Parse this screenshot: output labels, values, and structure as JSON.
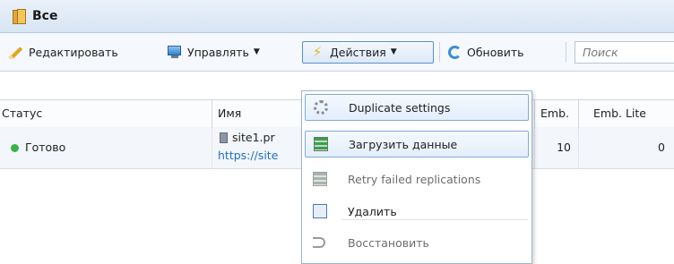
{
  "title": {
    "text": "Все",
    "icon": "folder-icon"
  },
  "toolbar": {
    "edit": {
      "label": "Редактировать",
      "icon": "pencil-icon"
    },
    "manage": {
      "label": "Управлять",
      "icon": "monitor-icon"
    },
    "actions": {
      "label": "Действия",
      "icon": "lightning-icon"
    },
    "refresh": {
      "label": "Обновить",
      "icon": "refresh-icon"
    },
    "search": {
      "placeholder": "Поиск"
    }
  },
  "table": {
    "columns": [
      "Статус",
      "Имя",
      "Emb.",
      "Emb. Lite"
    ],
    "rows": [
      {
        "status": "Готово",
        "status_color": "#3cb34a",
        "name": "site1.pr",
        "url": "https://site",
        "emb": "10",
        "emb_lite": "0"
      }
    ]
  },
  "menu": {
    "items": [
      {
        "label": "Duplicate settings",
        "icon": "gear-icon",
        "state": "highlighted"
      },
      {
        "label": "Загрузить данные",
        "icon": "load-data-icon",
        "state": "hover"
      },
      {
        "label": "Retry failed replications",
        "icon": "retry-icon",
        "state": "disabled"
      },
      {
        "label": "Удалить",
        "icon": "delete-icon",
        "state": "normal"
      },
      {
        "label": "Восстановить",
        "icon": "restore-icon",
        "state": "disabled"
      }
    ]
  }
}
